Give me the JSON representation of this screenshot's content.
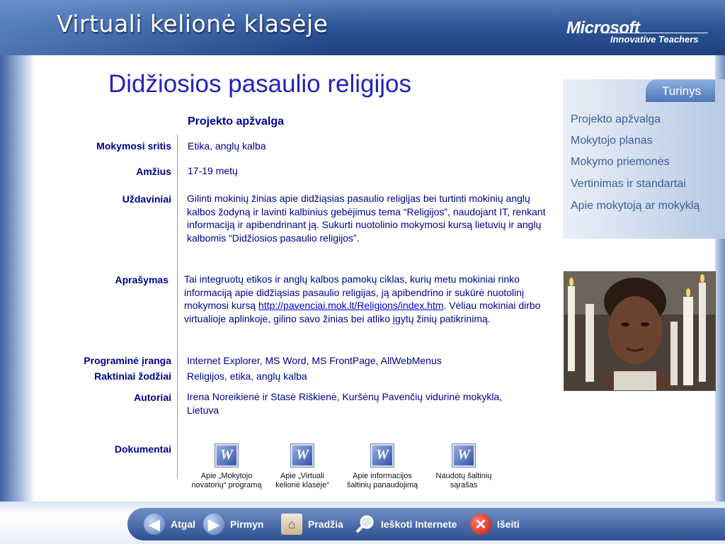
{
  "header": {
    "title": "Virtuali kelionė klasėje",
    "brand": "Microsoft",
    "brand_tagline": "Innovative Teachers"
  },
  "sidebar": {
    "tab_label": "Turinys",
    "items": [
      {
        "label": "Projekto apžvalga"
      },
      {
        "label": "Mokytojo planas"
      },
      {
        "label": "Mokymo priemonės"
      },
      {
        "label": "Vertinimas ir standartai"
      },
      {
        "label": "Apie mokytoją ar mokyklą"
      }
    ]
  },
  "main": {
    "title": "Didžiosios pasaulio religijos",
    "section_heading": "Projekto apžvalga",
    "fields": {
      "subject_label": "Mokymosi sritis",
      "subject_value": "Etika, anglų kalba",
      "age_label": "Amžius",
      "age_value": "17-19 metų",
      "tasks_label": "Uždaviniai",
      "tasks_value": "Gilinti mokinių žinias apie didžiąsias pasaulio religijas bei turtinti mokinių anglų kalbos žodyną ir lavinti kalbinius gebėjimus tema “Religijos”, naudojant IT, renkant informaciją ir apibendrinant ją. Sukurti nuotolinio mokymosi kursą lietuvių ir anglų kalbomis “Didžiosios pasaulio religijos”.",
      "description_label": "Aprašymas",
      "description_text_1": "Tai integruotų etikos ir anglų kalbos pamokų ciklas, kurių metu mokiniai rinko informaciją apie didžiąsias pasaulio religijas, ją apibendrino ir sukūrė nuotolinį mokymosi kursą",
      "description_link": "http://pavenciai.mok.lt/Religions/index.htm",
      "description_text_2": ". Vėliau mokiniai dirbo virtualioje aplinkoje, gilino savo žinias bei atliko įgytų  žinių patikrinimą.",
      "software_label": "Programinė įranga",
      "software_value": "Internet Explorer, MS Word, MS FrontPage, AllWebMenus",
      "keywords_label": "Raktiniai žodžiai",
      "keywords_value": "Religijos, etika, anglų kalba",
      "authors_label": "Autoriai",
      "authors_value": "Irena Noreikienė ir Stasė Riškienė, Kuršėnų Pavenčių vidurinė mokykla, Lietuva",
      "documents_label": "Dokumentai"
    },
    "documents": [
      {
        "icon": "word-document-icon",
        "glyph": "W",
        "caption_1": "Apie „Mokytojo",
        "caption_2": "novatorių“ programą"
      },
      {
        "icon": "word-document-icon",
        "glyph": "W",
        "caption_1": "Apie „Virtuali",
        "caption_2": "kelionė klasėje“"
      },
      {
        "icon": "word-document-icon",
        "glyph": "W",
        "caption_1": "Apie informacijos",
        "caption_2": "šaltinių panaudojimą"
      },
      {
        "icon": "word-document-icon",
        "glyph": "W",
        "caption_1": "Naudotų šaltinių",
        "caption_2": "sąrašas"
      }
    ]
  },
  "footer": {
    "buttons": [
      {
        "label": "Atgal",
        "icon": "arrow-left-icon"
      },
      {
        "label": "Pirmyn",
        "icon": "arrow-right-icon"
      },
      {
        "label": "Pradžia",
        "icon": "home-icon"
      },
      {
        "label": "Ieškoti Internete",
        "icon": "magnifier-icon"
      },
      {
        "label": "Išeiti",
        "icon": "close-x-icon"
      }
    ]
  },
  "colors": {
    "title": "#2222bb",
    "label": "#00008b",
    "header": "#2f5699",
    "menu": "#3d5c99"
  }
}
